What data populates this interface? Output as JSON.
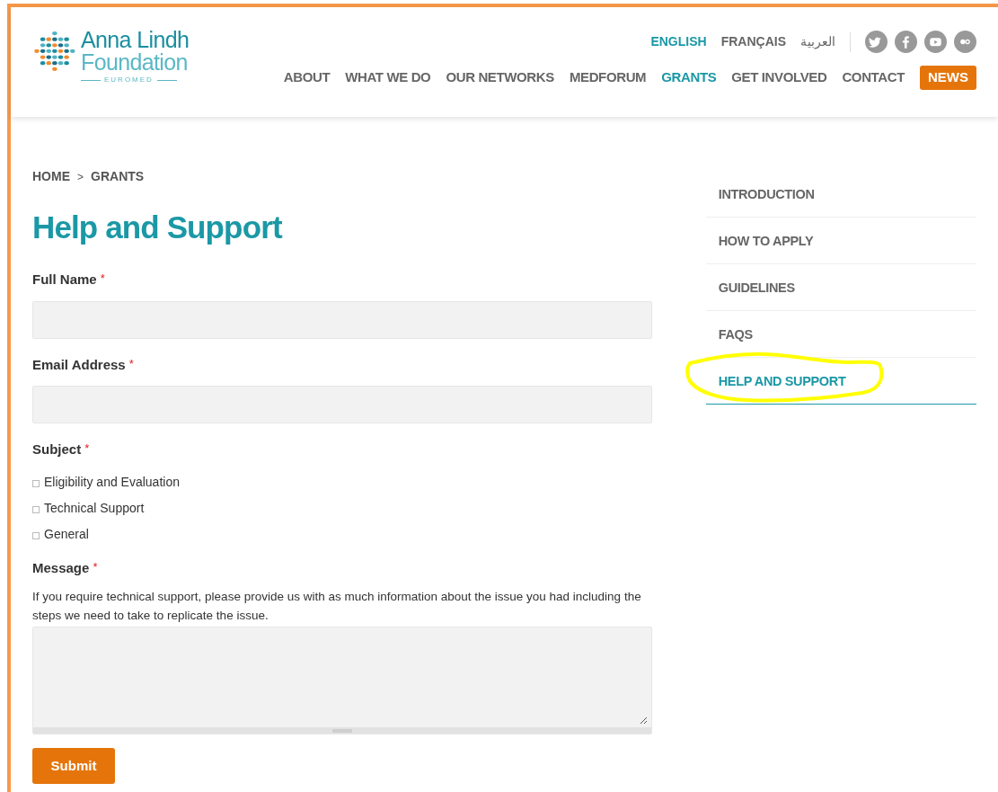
{
  "logo": {
    "name_line1": "Anna Lindh",
    "name_line2": "Foundation",
    "tagline": "EUROMED"
  },
  "languages": [
    {
      "label": "ENGLISH",
      "selected": true
    },
    {
      "label": "FRANÇAIS",
      "selected": false
    },
    {
      "label": "العربية",
      "selected": false
    }
  ],
  "social": [
    {
      "kind": "twitter"
    },
    {
      "kind": "facebook"
    },
    {
      "kind": "youtube"
    },
    {
      "kind": "flickr"
    }
  ],
  "nav": [
    {
      "label": "ABOUT",
      "selected": false,
      "kind": "link"
    },
    {
      "label": "WHAT WE DO",
      "selected": false,
      "kind": "link"
    },
    {
      "label": "OUR NETWORKS",
      "selected": false,
      "kind": "link"
    },
    {
      "label": "MEDFORUM",
      "selected": false,
      "kind": "link"
    },
    {
      "label": "GRANTS",
      "selected": true,
      "kind": "link"
    },
    {
      "label": "GET INVOLVED",
      "selected": false,
      "kind": "link"
    },
    {
      "label": "CONTACT",
      "selected": false,
      "kind": "link"
    },
    {
      "label": "NEWS",
      "selected": false,
      "kind": "button"
    }
  ],
  "breadcrumb": [
    {
      "label": "HOME"
    },
    {
      "label": "GRANTS"
    }
  ],
  "breadcrumb_separator": ">",
  "title": "Help and Support",
  "form": {
    "required_mark": "*",
    "full_name": {
      "label": "Full Name"
    },
    "email": {
      "label": "Email Address"
    },
    "subject": {
      "label": "Subject",
      "options": [
        {
          "label": "Eligibility and Evaluation",
          "checked": false
        },
        {
          "label": "Technical Support",
          "checked": false
        },
        {
          "label": "General",
          "checked": false
        }
      ]
    },
    "message": {
      "label": "Message",
      "help": "If you require technical support, please provide us with as much information about the issue you had including the steps we need to take to replicate the issue."
    },
    "submit": "Submit"
  },
  "sidebar": {
    "items": [
      {
        "label": "INTRODUCTION",
        "selected": false
      },
      {
        "label": "HOW TO APPLY",
        "selected": false
      },
      {
        "label": "GUIDELINES",
        "selected": false
      },
      {
        "label": "FAQS",
        "selected": false
      },
      {
        "label": "HELP AND SUPPORT",
        "selected": true
      }
    ]
  },
  "annotation": {
    "kind": "ellipse",
    "color": "#ffff00"
  }
}
